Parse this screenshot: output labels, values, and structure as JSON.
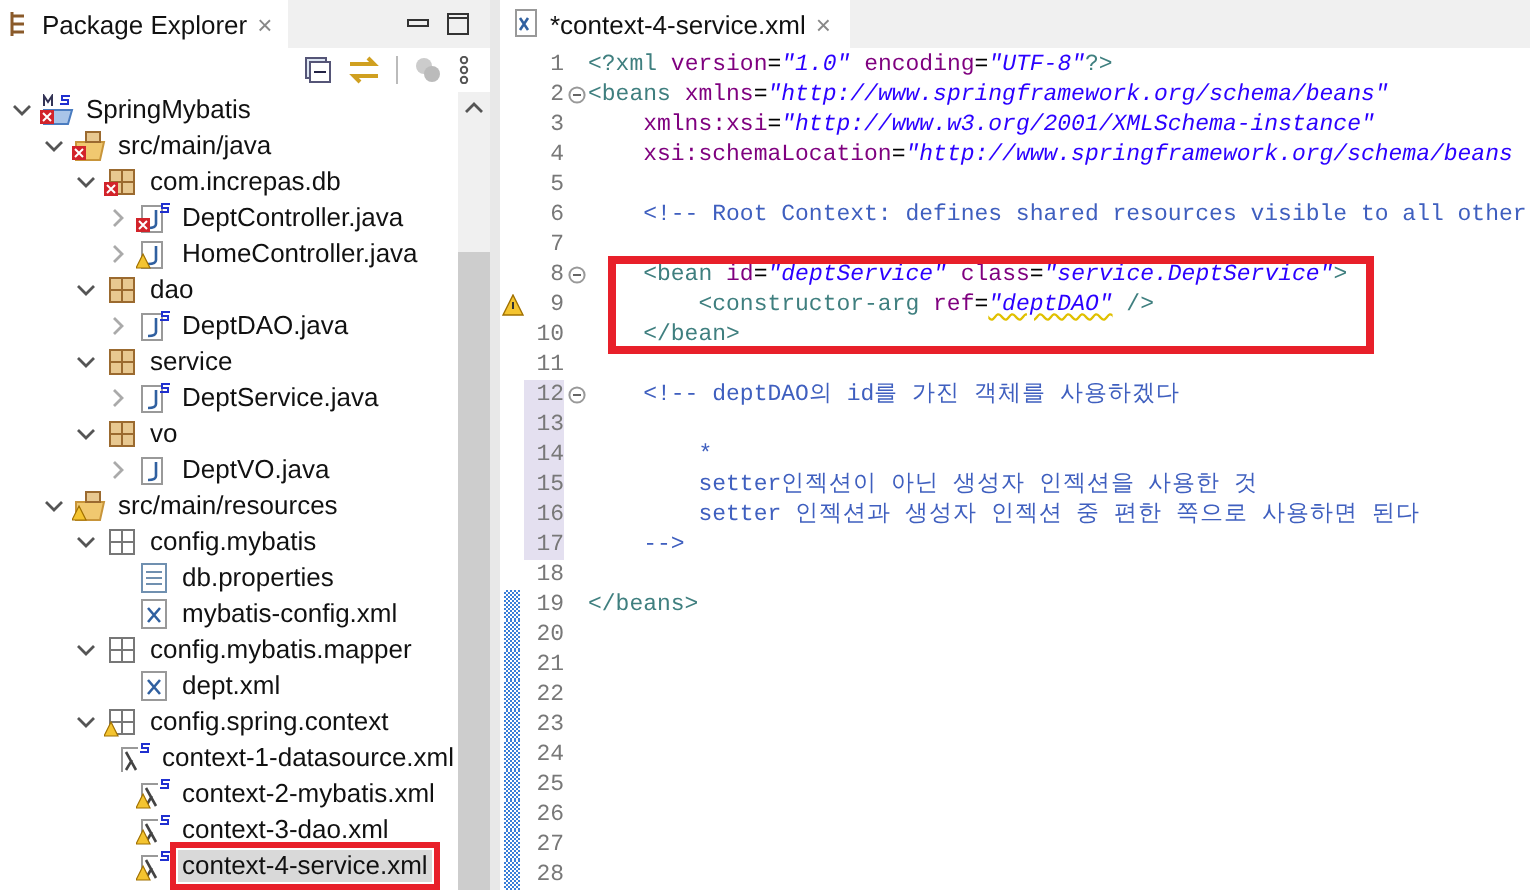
{
  "explorer": {
    "title": "Package Explorer",
    "close": "×",
    "tree": [
      {
        "name": "SpringMybatis",
        "kind": "project",
        "error": true,
        "expanded": true,
        "selected": false,
        "children": [
          {
            "name": "src/main/java",
            "kind": "srcfolder",
            "error": true,
            "expanded": true,
            "selected": false,
            "children": [
              {
                "name": "com.increpas.db",
                "kind": "package",
                "error": true,
                "expanded": true,
                "selected": false,
                "children": [
                  {
                    "name": "DeptController.java",
                    "kind": "springjava",
                    "error": true,
                    "expanded": false,
                    "selected": false
                  },
                  {
                    "name": "HomeController.java",
                    "kind": "java",
                    "warning": true,
                    "expanded": false,
                    "selected": false
                  }
                ]
              },
              {
                "name": "dao",
                "kind": "package",
                "expanded": true,
                "selected": false,
                "children": [
                  {
                    "name": "DeptDAO.java",
                    "kind": "springjava",
                    "expanded": false,
                    "selected": false
                  }
                ]
              },
              {
                "name": "service",
                "kind": "package",
                "expanded": true,
                "selected": false,
                "children": [
                  {
                    "name": "DeptService.java",
                    "kind": "springjava",
                    "expanded": false,
                    "selected": false
                  }
                ]
              },
              {
                "name": "vo",
                "kind": "package",
                "expanded": true,
                "selected": false,
                "children": [
                  {
                    "name": "DeptVO.java",
                    "kind": "java",
                    "expanded": false,
                    "selected": false
                  }
                ]
              }
            ]
          },
          {
            "name": "src/main/resources",
            "kind": "srcfolder",
            "warning": true,
            "expanded": true,
            "selected": false,
            "children": [
              {
                "name": "config.mybatis",
                "kind": "folder",
                "expanded": true,
                "selected": false,
                "children": [
                  {
                    "name": "db.properties",
                    "kind": "properties",
                    "selected": false
                  },
                  {
                    "name": "mybatis-config.xml",
                    "kind": "xml",
                    "selected": false
                  }
                ]
              },
              {
                "name": "config.mybatis.mapper",
                "kind": "folder",
                "expanded": true,
                "selected": false,
                "children": [
                  {
                    "name": "dept.xml",
                    "kind": "xml",
                    "selected": false
                  }
                ]
              },
              {
                "name": "config.spring.context",
                "kind": "folder",
                "warning": true,
                "expanded": true,
                "selected": false,
                "children": [
                  {
                    "name": "context-1-datasource.xml",
                    "kind": "springxml",
                    "selected": false
                  },
                  {
                    "name": "context-2-mybatis.xml",
                    "kind": "springxml",
                    "warning": true,
                    "selected": false
                  },
                  {
                    "name": "context-3-dao.xml",
                    "kind": "springxml",
                    "warning": true,
                    "selected": false
                  },
                  {
                    "name": "context-4-service.xml",
                    "kind": "springxml",
                    "warning": true,
                    "selected": true,
                    "annotated": true
                  }
                ]
              }
            ]
          }
        ]
      }
    ]
  },
  "editor": {
    "tab": "*context-4-service.xml",
    "close": "×",
    "lines": [
      {
        "number": "1",
        "tokens": [
          {
            "kind": "tag",
            "text": "<?xml "
          },
          {
            "kind": "attr",
            "text": "version"
          },
          {
            "kind": "plain",
            "text": "="
          },
          {
            "kind": "value",
            "text": "\"1.0\" "
          },
          {
            "kind": "attr",
            "text": "encoding"
          },
          {
            "kind": "plain",
            "text": "="
          },
          {
            "kind": "value",
            "text": "\"UTF-8\""
          },
          {
            "kind": "tag",
            "text": "?>"
          }
        ]
      },
      {
        "number": "2",
        "fold": true,
        "tokens": [
          {
            "kind": "tag",
            "text": "<beans "
          },
          {
            "kind": "attr",
            "text": "xmlns"
          },
          {
            "kind": "plain",
            "text": "="
          },
          {
            "kind": "value",
            "text": "\"http://www.springframework.org/schema/beans\""
          }
        ]
      },
      {
        "number": "3",
        "tokens": [
          {
            "kind": "attr",
            "text": "    xmlns:xsi"
          },
          {
            "kind": "plain",
            "text": "="
          },
          {
            "kind": "value",
            "text": "\"http://www.w3.org/2001/XMLSchema-instance\""
          }
        ]
      },
      {
        "number": "4",
        "tokens": [
          {
            "kind": "attr",
            "text": "    xsi:schemaLocation"
          },
          {
            "kind": "plain",
            "text": "="
          },
          {
            "kind": "value",
            "text": "\"http://www.springframework.org/schema/beans"
          }
        ]
      },
      {
        "number": "5"
      },
      {
        "number": "6",
        "tokens": [
          {
            "kind": "comment",
            "text": "    <!-- Root Context: defines shared resources visible to all other"
          }
        ]
      },
      {
        "number": "7"
      },
      {
        "number": "8",
        "fold": true,
        "boxed": true,
        "tokens": [
          {
            "kind": "tag",
            "text": "    <bean "
          },
          {
            "kind": "attr",
            "text": "id"
          },
          {
            "kind": "plain",
            "text": "="
          },
          {
            "kind": "value",
            "text": "\"deptService\" "
          },
          {
            "kind": "attr",
            "text": "class"
          },
          {
            "kind": "plain",
            "text": "="
          },
          {
            "kind": "value",
            "text": "\"service.DeptService\""
          },
          {
            "kind": "tag",
            "text": ">"
          }
        ]
      },
      {
        "number": "9",
        "warning": true,
        "boxed": true,
        "tokens": [
          {
            "kind": "tag",
            "text": "        <constructor-arg "
          },
          {
            "kind": "attr",
            "text": "ref"
          },
          {
            "kind": "plain",
            "text": "="
          },
          {
            "kind": "value",
            "text": "\"deptDAO\"",
            "squiggle": true
          },
          {
            "kind": "tag",
            "text": " />"
          }
        ]
      },
      {
        "number": "10",
        "boxed": true,
        "tokens": [
          {
            "kind": "tag",
            "text": "    </bean>"
          }
        ]
      },
      {
        "number": "11"
      },
      {
        "number": "12",
        "fold": true,
        "highlighted": true,
        "tokens": [
          {
            "kind": "comment",
            "text": "    <!-- deptDAO의 id를 가진 객체를 사용하겠다"
          }
        ]
      },
      {
        "number": "13",
        "highlighted": true
      },
      {
        "number": "14",
        "highlighted": true,
        "tokens": [
          {
            "kind": "comment",
            "text": "        *"
          }
        ]
      },
      {
        "number": "15",
        "highlighted": true,
        "tokens": [
          {
            "kind": "comment",
            "text": "        setter인젝션이 아닌 생성자 인젝션을 사용한 것"
          }
        ]
      },
      {
        "number": "16",
        "highlighted": true,
        "tokens": [
          {
            "kind": "comment",
            "text": "        setter 인젝션과 생성자 인젝션 중 편한 쪽으로 사용하면 된다"
          }
        ]
      },
      {
        "number": "17",
        "highlighted": true,
        "tokens": [
          {
            "kind": "comment",
            "text": "    -->"
          }
        ]
      },
      {
        "number": "18"
      },
      {
        "number": "19",
        "changed": true,
        "tokens": [
          {
            "kind": "tag",
            "text": "</beans>"
          }
        ]
      },
      {
        "number": "20",
        "changed": true
      },
      {
        "number": "21",
        "changed": true
      },
      {
        "number": "22",
        "changed": true
      },
      {
        "number": "23",
        "changed": true
      },
      {
        "number": "24",
        "changed": true
      },
      {
        "number": "25",
        "changed": true
      },
      {
        "number": "26",
        "changed": true
      },
      {
        "number": "27",
        "changed": true
      },
      {
        "number": "28",
        "changed": true
      }
    ]
  }
}
